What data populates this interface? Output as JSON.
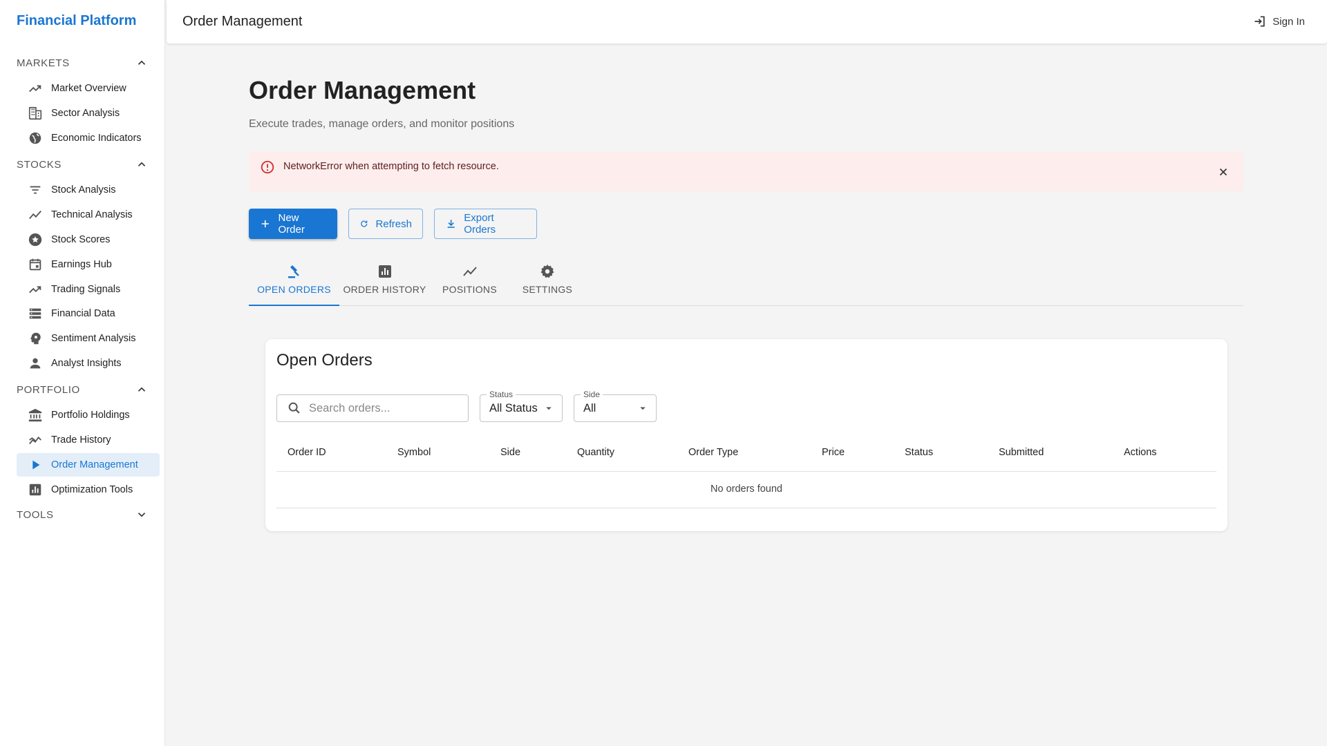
{
  "app": {
    "brand": "Financial Platform"
  },
  "sidebar": {
    "sections": {
      "markets": "MARKETS",
      "stocks": "STOCKS",
      "portfolio": "PORTFOLIO",
      "tools": "TOOLS"
    },
    "items": {
      "market_overview": "Market Overview",
      "sector_analysis": "Sector Analysis",
      "economic_indicators": "Economic Indicators",
      "stock_analysis": "Stock Analysis",
      "technical_analysis": "Technical Analysis",
      "stock_scores": "Stock Scores",
      "earnings_hub": "Earnings Hub",
      "trading_signals": "Trading Signals",
      "financial_data": "Financial Data",
      "sentiment_analysis": "Sentiment Analysis",
      "analyst_insights": "Analyst Insights",
      "portfolio_holdings": "Portfolio Holdings",
      "trade_history": "Trade History",
      "order_management": "Order Management",
      "optimization_tools": "Optimization Tools"
    },
    "active_item": "order_management"
  },
  "topbar": {
    "title": "Order Management",
    "signin_label": "Sign In"
  },
  "main": {
    "title": "Order Management",
    "subtitle": "Execute trades, manage orders, and monitor positions",
    "alert": {
      "message": "NetworkError when attempting to fetch resource.",
      "severity": "error"
    },
    "actions": {
      "new_order": "New Order",
      "refresh": "Refresh",
      "export": "Export Orders"
    },
    "tabs": {
      "open_orders": "OPEN ORDERS",
      "order_history": "ORDER HISTORY",
      "positions": "POSITIONS",
      "settings": "SETTINGS"
    },
    "active_tab": "open_orders"
  },
  "orders_card": {
    "title": "Open Orders",
    "search_placeholder": "Search orders...",
    "filters": {
      "status_label": "Status",
      "status_value": "All Status",
      "side_label": "Side",
      "side_value": "All"
    },
    "columns": {
      "order_id": "Order ID",
      "symbol": "Symbol",
      "side": "Side",
      "quantity": "Quantity",
      "order_type": "Order Type",
      "price": "Price",
      "status": "Status",
      "submitted": "Submitted",
      "actions": "Actions"
    },
    "empty_message": "No orders found"
  },
  "colors": {
    "accent": "#1976d2",
    "alert_bg": "#fdeded",
    "alert_icon": "#d32f2f",
    "active_nav_bg": "#e3eef9"
  }
}
